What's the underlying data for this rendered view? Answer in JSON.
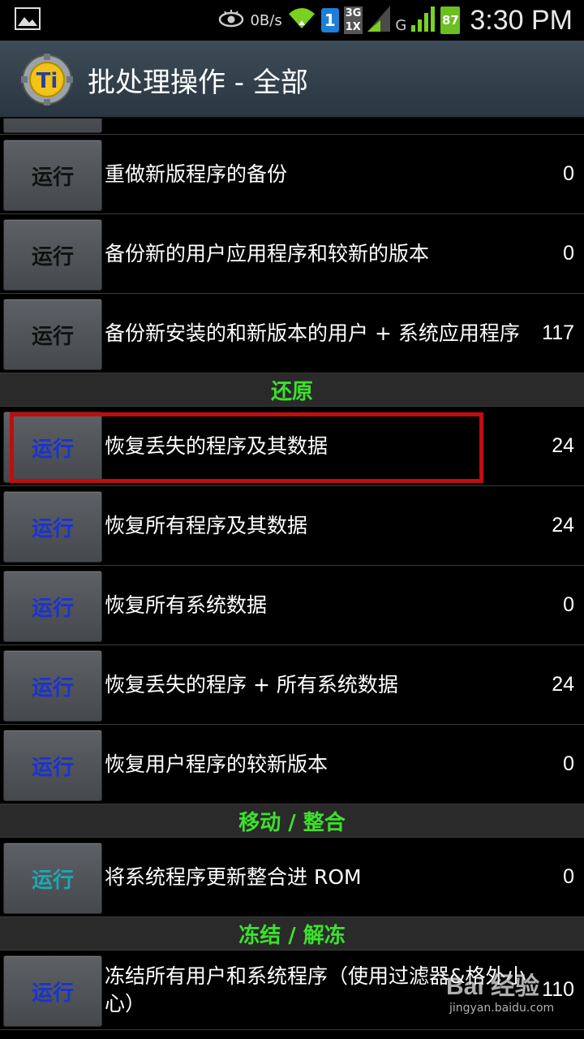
{
  "statusbar": {
    "data_rate": "0B/s",
    "sim": "1",
    "network_top": "3G",
    "network_bottom": "1X",
    "network_g": "G",
    "battery": "87",
    "time": "3:30 PM"
  },
  "app": {
    "title": "批处理操作 - 全部"
  },
  "colors": {
    "section_header": "#3be22a",
    "highlight": "#c10d0d",
    "restore_button_text": "#1a32d6",
    "move_button_text": "#1da8b0"
  },
  "run_label": "运行",
  "backup_rows": [
    {
      "label": "重做新版程序的备份",
      "count": "0"
    },
    {
      "label": "备份新的用户应用程序和较新的版本",
      "count": "0"
    },
    {
      "label": "备份新安装的和新版本的用户 + 系统应用程序",
      "count": "117"
    }
  ],
  "sections": {
    "restore": "还原",
    "move": "移动 / 整合",
    "freeze": "冻结 / 解冻"
  },
  "restore_rows": [
    {
      "label": "恢复丢失的程序及其数据",
      "count": "24"
    },
    {
      "label": "恢复所有程序及其数据",
      "count": "24"
    },
    {
      "label": "恢复所有系统数据",
      "count": "0"
    },
    {
      "label": "恢复丢失的程序 + 所有系统数据",
      "count": "24"
    },
    {
      "label": "恢复用户程序的较新版本",
      "count": "0"
    }
  ],
  "move_rows": [
    {
      "label": "将系统程序更新整合进 ROM",
      "count": "0"
    }
  ],
  "freeze_rows": [
    {
      "label": "冻结所有用户和系统程序（使用过滤器&格外小心）",
      "count": "110"
    }
  ],
  "watermark": {
    "main": "Bai 经验",
    "sub": "jingyan.baidu.com"
  }
}
